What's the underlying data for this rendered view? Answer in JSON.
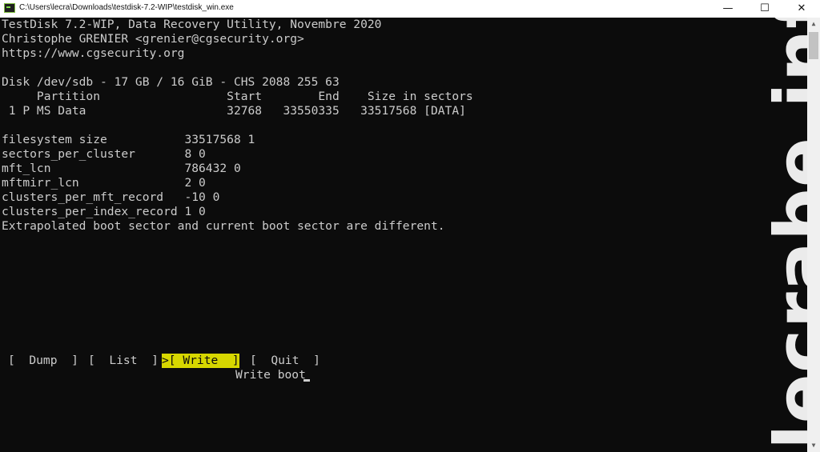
{
  "window": {
    "title": "C:\\Users\\lecra\\Downloads\\testdisk-7.2-WIP\\testdisk_win.exe",
    "minimize": "—",
    "maximize": "☐",
    "close": "✕"
  },
  "terminal": {
    "lines": [
      "TestDisk 7.2-WIP, Data Recovery Utility, Novembre 2020",
      "Christophe GRENIER <grenier@cgsecurity.org>",
      "https://www.cgsecurity.org",
      "",
      "Disk /dev/sdb - 17 GB / 16 GiB - CHS 2088 255 63",
      "     Partition                  Start        End    Size in sectors",
      " 1 P MS Data                    32768   33550335   33517568 [DATA]",
      "",
      "filesystem size           33517568 1",
      "sectors_per_cluster       8 0",
      "mft_lcn                   786432 0",
      "mftmirr_lcn               2 0",
      "clusters_per_mft_record   -10 0",
      "clusters_per_index_record 1 0",
      "Extrapolated boot sector and current boot sector are different."
    ],
    "menu": {
      "dump": "[  Dump  ]",
      "list": "[  List  ]",
      "write": ">[ Write  ]",
      "quit": "[  Quit  ]"
    },
    "status": "Write boot"
  },
  "watermark": "lecrabe.info",
  "colors": {
    "terminal_bg": "#0c0c0c",
    "terminal_fg": "#cccccc",
    "selection_bg": "#d7d700"
  }
}
